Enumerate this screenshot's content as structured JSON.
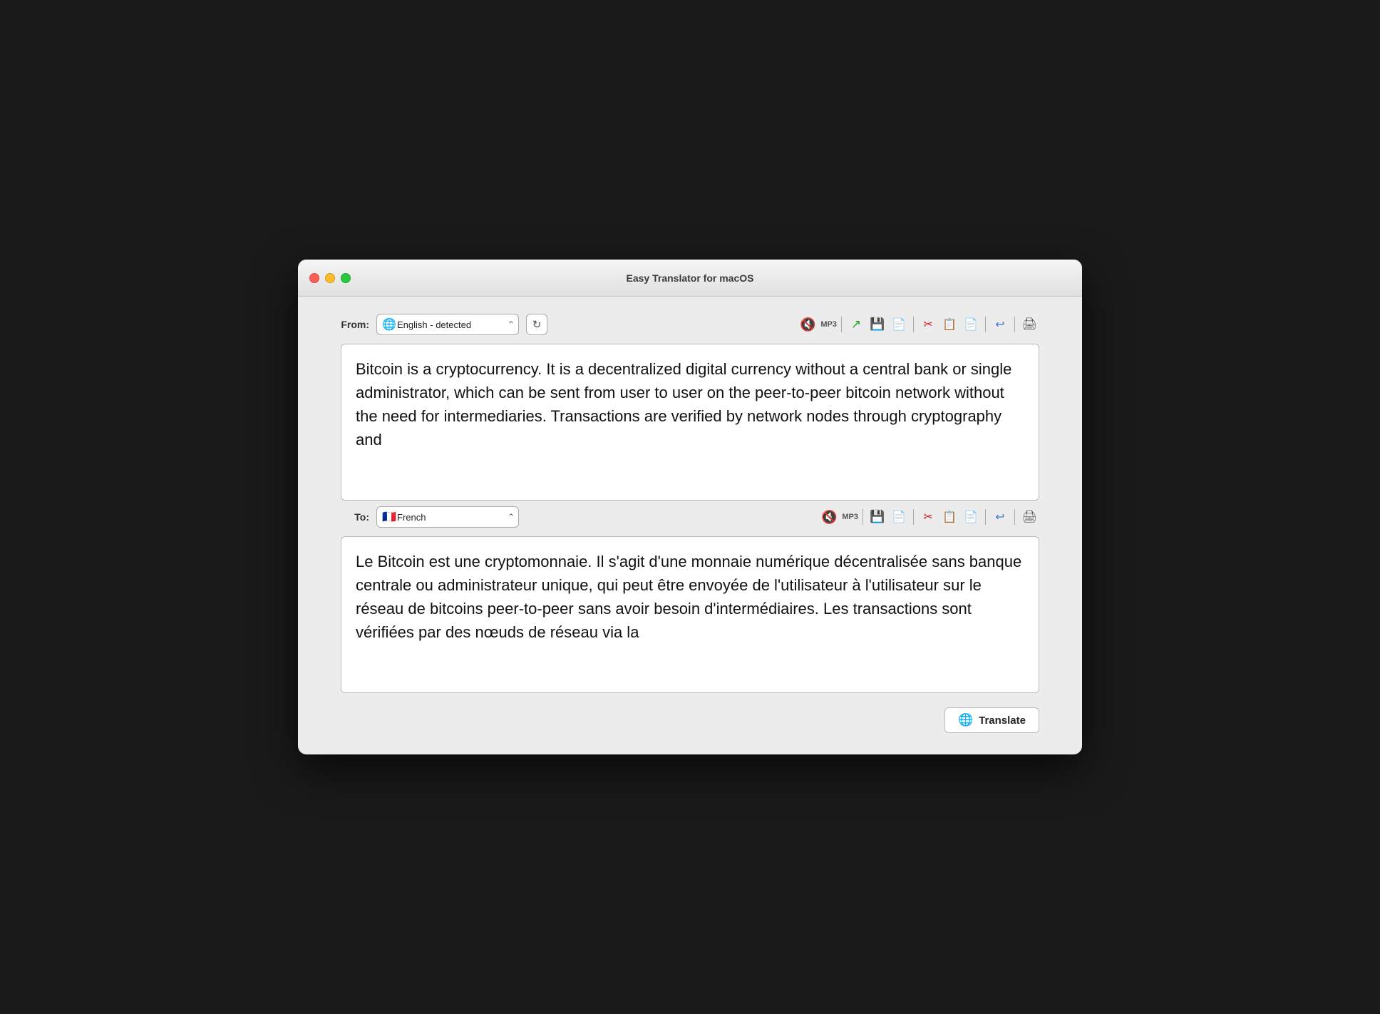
{
  "window": {
    "title": "Easy Translator for macOS"
  },
  "from_section": {
    "label": "From:",
    "language_value": "English - detected",
    "language_flag": "🌐",
    "refresh_tooltip": "Refresh"
  },
  "to_section": {
    "label": "To:",
    "language_value": "French",
    "language_flag": "🇫🇷"
  },
  "source_text": "Bitcoin is a cryptocurrency. It is a decentralized digital currency without a central bank or single administrator, which can be sent from user to user on the peer-to-peer bitcoin network without the need for intermediaries.\n\nTransactions are verified by network nodes through cryptography and",
  "translated_text": "Le Bitcoin est une cryptomonnaie. Il s'agit d'une monnaie numérique décentralisée sans banque centrale ou administrateur unique, qui peut être envoyée de l'utilisateur à l'utilisateur sur le réseau de bitcoins peer-to-peer sans avoir besoin d'intermédiaires.\n\nLes transactions sont vérifiées par des nœuds de réseau via la",
  "toolbar": {
    "mp3_label": "MP3",
    "translate_label": "Translate"
  },
  "controls": {
    "close_label": "close",
    "minimize_label": "minimize",
    "maximize_label": "maximize"
  }
}
